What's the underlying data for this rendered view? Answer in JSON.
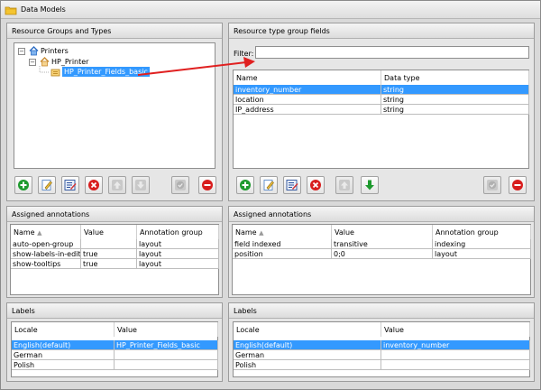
{
  "window": {
    "title": "Data Models",
    "icon": "folder-icon"
  },
  "resource_groups": {
    "header": "Resource Groups and Types",
    "tree": [
      {
        "label": "Printers",
        "icon": "house-icon",
        "expanded": true
      },
      {
        "label": "HP_Printer",
        "icon": "house-icon",
        "expanded": true
      },
      {
        "label": "HP_Printer_Fields_basic",
        "icon": "type-icon",
        "selected": true
      }
    ],
    "toolbar": [
      "add-icon",
      "edit-icon",
      "edit-fields-icon",
      "delete-icon",
      "move-up-icon",
      "move-down-icon",
      "check-icon",
      "remove-icon"
    ]
  },
  "type_fields": {
    "header": "Resource type group fields",
    "filter_label": "Filter:",
    "filter_value": "",
    "columns": [
      "Name",
      "Data type"
    ],
    "rows": [
      {
        "name": "inventory_number",
        "type": "string",
        "selected": true
      },
      {
        "name": "location",
        "type": "string",
        "selected": false
      },
      {
        "name": "IP_address",
        "type": "string",
        "selected": false
      }
    ],
    "toolbar": [
      "add-icon",
      "edit-icon",
      "edit-fields-icon",
      "delete-icon",
      "move-up-icon",
      "move-down-icon",
      "check-icon",
      "remove-icon"
    ]
  },
  "left_annotations": {
    "header": "Assigned annotations",
    "columns": [
      "Name",
      "Value",
      "Annotation group"
    ],
    "rows": [
      {
        "name": "auto-open-group",
        "value": "",
        "group": "layout"
      },
      {
        "name": "show-labels-in-edit",
        "value": "true",
        "group": "layout"
      },
      {
        "name": "show-tooltips",
        "value": "true",
        "group": "layout"
      }
    ]
  },
  "right_annotations": {
    "header": "Assigned annotations",
    "columns": [
      "Name",
      "Value",
      "Annotation group"
    ],
    "rows": [
      {
        "name": "field indexed",
        "value": "transitive",
        "group": "indexing"
      },
      {
        "name": "position",
        "value": "0;0",
        "group": "layout"
      }
    ]
  },
  "left_labels": {
    "header": "Labels",
    "columns": [
      "Locale",
      "Value"
    ],
    "rows": [
      {
        "locale": "English(default)",
        "value": "HP_Printer_Fields_basic",
        "selected": true
      },
      {
        "locale": "German",
        "value": "",
        "selected": false
      },
      {
        "locale": "Polish",
        "value": "",
        "selected": false
      }
    ]
  },
  "right_labels": {
    "header": "Labels",
    "columns": [
      "Locale",
      "Value"
    ],
    "rows": [
      {
        "locale": "English(default)",
        "value": "inventory_number",
        "selected": true
      },
      {
        "locale": "German",
        "value": "",
        "selected": false
      },
      {
        "locale": "Polish",
        "value": "",
        "selected": false
      }
    ]
  },
  "colors": {
    "selection": "#3399ff",
    "arrow": "#e02020",
    "add": "#1e9a2e",
    "delete": "#d81e1e"
  }
}
